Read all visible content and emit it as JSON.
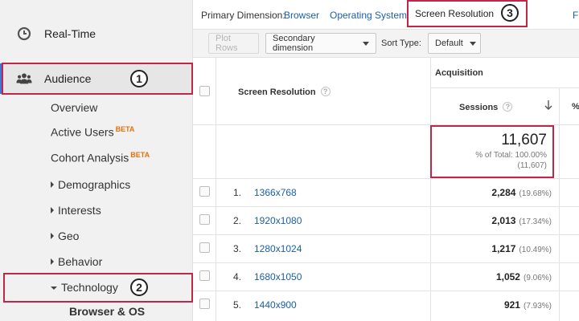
{
  "sidebar": {
    "realtime": {
      "label": "Real-Time",
      "icon": "clock-icon"
    },
    "audience": {
      "label": "Audience",
      "icon": "people-icon"
    },
    "items": {
      "overview": "Overview",
      "active_users": "Active Users",
      "cohort_analysis": "Cohort Analysis",
      "demographics": "Demographics",
      "interests": "Interests",
      "geo": "Geo",
      "behavior": "Behavior",
      "technology": "Technology",
      "browser_os": "Browser & OS"
    },
    "beta_label": "BETA"
  },
  "callouts": {
    "one": "1",
    "two": "2",
    "three": "3"
  },
  "dimensions": {
    "label": "Primary Dimension:",
    "browser": "Browser",
    "os": "Operating System",
    "active": "Screen Resolution",
    "more": "F"
  },
  "toolbar": {
    "plot_rows": "Plot Rows",
    "secondary_dimension": "Secondary dimension",
    "sort_type_label": "Sort Type:",
    "sort_type_value": "Default"
  },
  "table": {
    "col_dimension": "Screen Resolution",
    "group_acquisition": "Acquisition",
    "col_sessions": "Sessions",
    "col_next": "%",
    "totals": {
      "value": "11,607",
      "pct_line": "% of Total: 100.00%",
      "abs_line": "(11,607)"
    },
    "rows": [
      {
        "num": "1.",
        "name": "1366x768",
        "sessions": "2,284",
        "pct": "(19.68%)"
      },
      {
        "num": "2.",
        "name": "1920x1080",
        "sessions": "2,013",
        "pct": "(17.34%)"
      },
      {
        "num": "3.",
        "name": "1280x1024",
        "sessions": "1,217",
        "pct": "(10.49%)"
      },
      {
        "num": "4.",
        "name": "1680x1050",
        "sessions": "1,052",
        "pct": "(9.06%)"
      },
      {
        "num": "5.",
        "name": "1440x900",
        "sessions": "921",
        "pct": "(7.93%)"
      }
    ]
  },
  "colors": {
    "callout": "#c0264a",
    "link": "#1a5fa8",
    "accent": "#3c78d8",
    "beta": "#e8710a"
  }
}
